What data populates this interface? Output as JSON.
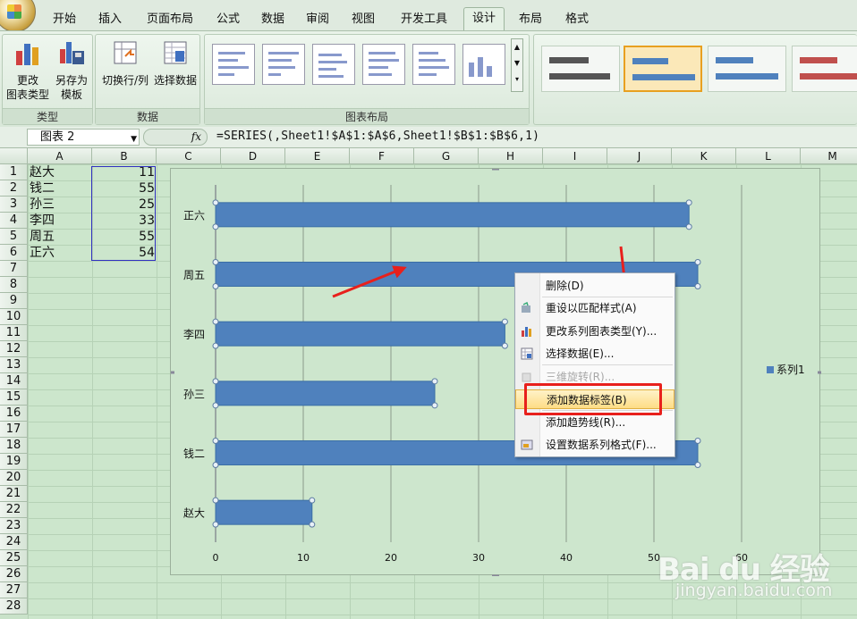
{
  "tabs": [
    "开始",
    "插入",
    "页面布局",
    "公式",
    "数据",
    "审阅",
    "视图",
    "开发工具",
    "设计",
    "布局",
    "格式"
  ],
  "active_tab": "设计",
  "ribbon": {
    "type_group": {
      "label": "类型",
      "change_type_l1": "更改",
      "change_type_l2": "图表类型",
      "save_template_l1": "另存为",
      "save_template_l2": "模板"
    },
    "data_group": {
      "label": "数据",
      "switch_row_col": "切换行/列",
      "select_data": "选择数据"
    },
    "layout_group": {
      "label": "图表布局"
    }
  },
  "formula_bar": {
    "name_box": "图表 2",
    "fx": "fx",
    "formula": "=SERIES(,Sheet1!$A$1:$A$6,Sheet1!$B$1:$B$6,1)"
  },
  "columns": [
    "A",
    "B",
    "C",
    "D",
    "E",
    "F",
    "G",
    "H",
    "I",
    "J",
    "K",
    "L",
    "M"
  ],
  "rows": [
    "1",
    "2",
    "3",
    "4",
    "5",
    "6",
    "7",
    "8",
    "9",
    "10",
    "11",
    "12",
    "13",
    "14",
    "15",
    "16",
    "17",
    "18",
    "19",
    "20",
    "21",
    "22",
    "23",
    "24",
    "25",
    "26",
    "27",
    "28"
  ],
  "sheet": [
    {
      "name": "赵大",
      "value": "11"
    },
    {
      "name": "钱二",
      "value": "55"
    },
    {
      "name": "孙三",
      "value": "25"
    },
    {
      "name": "李四",
      "value": "33"
    },
    {
      "name": "周五",
      "value": "55"
    },
    {
      "name": "正六",
      "value": "54"
    }
  ],
  "chart_data": {
    "type": "bar",
    "orientation": "horizontal",
    "categories": [
      "赵大",
      "钱二",
      "孙三",
      "李四",
      "周五",
      "正六"
    ],
    "series": [
      {
        "name": "系列1",
        "values": [
          11,
          55,
          25,
          33,
          55,
          54
        ]
      }
    ],
    "x_ticks": [
      "0",
      "10",
      "20",
      "30",
      "40",
      "50",
      "60"
    ],
    "xlim": [
      0,
      60
    ],
    "grid": "vertical",
    "legend": "right",
    "bar_color": "#4f81bd"
  },
  "context_menu": {
    "items": [
      {
        "label": "删除(D)",
        "enabled": true,
        "icon": ""
      },
      {
        "label": "重设以匹配样式(A)",
        "enabled": true,
        "icon": "reset-style-icon"
      },
      {
        "label": "更改系列图表类型(Y)...",
        "enabled": true,
        "icon": "chart-type-icon"
      },
      {
        "label": "选择数据(E)...",
        "enabled": true,
        "icon": "select-data-icon"
      },
      {
        "label": "三维旋转(R)...",
        "enabled": false,
        "icon": "3d-rotate-icon"
      },
      {
        "label": "添加数据标签(B)",
        "enabled": true,
        "icon": "",
        "highlighted": true
      },
      {
        "label": "添加趋势线(R)...",
        "enabled": true,
        "icon": ""
      },
      {
        "label": "设置数据系列格式(F)...",
        "enabled": true,
        "icon": "format-series-icon"
      }
    ]
  },
  "watermark": {
    "logo": "Bai du 经验",
    "url": "jingyan.baidu.com"
  },
  "colors": {
    "annotation": "#e8201c",
    "bar": "#4f81bd",
    "sheet_bg": "#cce6cc"
  }
}
